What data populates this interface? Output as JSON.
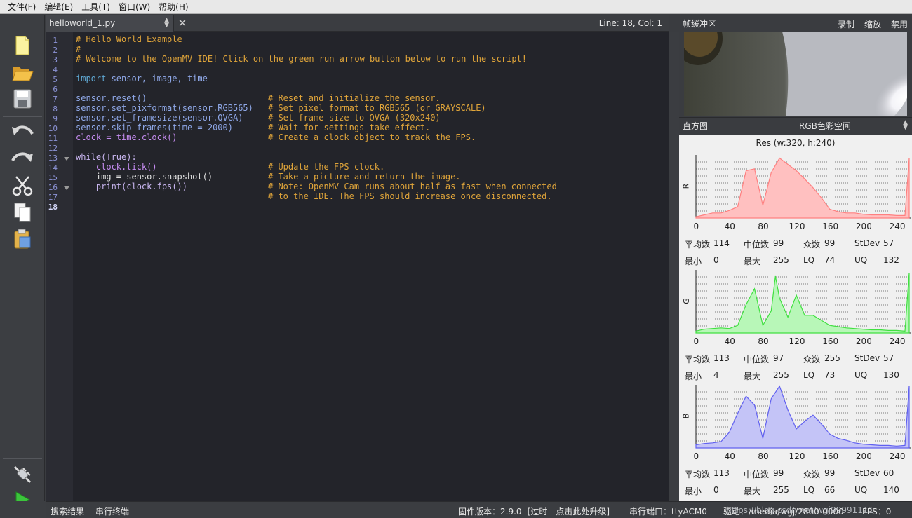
{
  "menu": [
    "文件(F)",
    "编辑(E)",
    "工具(T)",
    "窗口(W)",
    "帮助(H)"
  ],
  "editor": {
    "tab_name": "helloworld_1.py",
    "position": "Line: 18, Col: 1",
    "line_numbers": [
      "1",
      "2",
      "3",
      "4",
      "5",
      "6",
      "7",
      "8",
      "9",
      "10",
      "11",
      "12",
      "13",
      "14",
      "15",
      "16",
      "17",
      "18"
    ],
    "lines": {
      "l1": "# Hello World Example",
      "l2": "#",
      "l3": "# Welcome to the OpenMV IDE! Click on the green run arrow button below to run the script!",
      "l5_kw": "import",
      "l5_rest": " sensor, image, time",
      "l7_code": "sensor.reset()",
      "l7_comment": "# Reset and initialize the sensor.",
      "l8_code": "sensor.set_pixformat(sensor.RGB565)",
      "l8_comment": "# Set pixel format to RGB565 (or GRAYSCALE)",
      "l9_code": "sensor.set_framesize(sensor.QVGA)",
      "l9_comment": "# Set frame size to QVGA (320x240)",
      "l10_code": "sensor.skip_frames(time = 2000)",
      "l10_comment": "# Wait for settings take effect.",
      "l11_code": "clock = time.clock()",
      "l11_comment": "# Create a clock object to track the FPS.",
      "l13": "while(True):",
      "l14_code": "    clock.tick()",
      "l14_comment": "# Update the FPS clock.",
      "l15_code": "    img = sensor.snapshot()",
      "l15_comment": "# Take a picture and return the image.",
      "l16_code": "    print(clock.fps())",
      "l16_comment": "# Note: OpenMV Cam runs about half as fast when connected",
      "l17_comment": "# to the IDE. The FPS should increase once disconnected."
    }
  },
  "frame_buffer": {
    "title": "帧缓冲区",
    "record": "录制",
    "zoom": "缩放",
    "disable": "禁用"
  },
  "histogram": {
    "title": "直方图",
    "color_space": "RGB色彩空间",
    "resolution": "Res (w:320, h:240)",
    "ticks": [
      "0",
      "40",
      "80",
      "120",
      "160",
      "200",
      "240"
    ],
    "stat_labels": {
      "mean": "平均数",
      "median": "中位数",
      "mode": "众数",
      "stdev": "StDev",
      "min": "最小",
      "max": "最大",
      "lq": "LQ",
      "uq": "UQ"
    },
    "channels": [
      {
        "name": "R",
        "color": "#ff8080",
        "fill": "#ffc0c0",
        "mean": "114",
        "median": "99",
        "mode": "99",
        "stdev": "57",
        "min": "0",
        "max": "255",
        "lq": "74",
        "uq": "132"
      },
      {
        "name": "G",
        "color": "#40e040",
        "fill": "#b8f7b8",
        "mean": "113",
        "median": "97",
        "mode": "255",
        "stdev": "57",
        "min": "4",
        "max": "255",
        "lq": "73",
        "uq": "130"
      },
      {
        "name": "B",
        "color": "#6060f0",
        "fill": "#c4c4f7",
        "mean": "113",
        "median": "99",
        "mode": "99",
        "stdev": "60",
        "min": "0",
        "max": "255",
        "lq": "66",
        "uq": "140"
      }
    ]
  },
  "status": {
    "search_results": "搜索结果",
    "serial_terminal": "串行终端",
    "firmware": "固件版本：2.9.0- [过时 - 点击此处升级]",
    "serial_port": "串行端口：ttyACM0",
    "drive": "驱动：/media/wgj/2800-0000",
    "fps": "FPS：0",
    "watermark": "https://blog.csdn.net/wgj99991111"
  },
  "chart_data": [
    {
      "type": "area",
      "title": "R",
      "x": [
        0,
        10,
        20,
        30,
        40,
        50,
        60,
        70,
        80,
        90,
        100,
        110,
        120,
        130,
        140,
        150,
        160,
        170,
        180,
        190,
        200,
        210,
        220,
        230,
        240,
        250,
        255
      ],
      "values": [
        0.02,
        0.05,
        0.08,
        0.08,
        0.12,
        0.18,
        0.75,
        0.78,
        0.2,
        0.72,
        0.95,
        0.85,
        0.75,
        0.62,
        0.48,
        0.32,
        0.14,
        0.1,
        0.08,
        0.08,
        0.06,
        0.05,
        0.05,
        0.05,
        0.04,
        0.04,
        0.95
      ],
      "xlim": [
        0,
        255
      ]
    },
    {
      "type": "area",
      "title": "G",
      "x": [
        0,
        10,
        20,
        30,
        40,
        50,
        60,
        70,
        80,
        90,
        95,
        100,
        110,
        120,
        130,
        140,
        150,
        160,
        170,
        180,
        190,
        200,
        210,
        220,
        230,
        240,
        250,
        255
      ],
      "values": [
        0.03,
        0.06,
        0.07,
        0.08,
        0.07,
        0.12,
        0.45,
        0.7,
        0.12,
        0.35,
        0.9,
        0.55,
        0.25,
        0.6,
        0.28,
        0.28,
        0.2,
        0.12,
        0.1,
        0.08,
        0.07,
        0.06,
        0.05,
        0.05,
        0.04,
        0.04,
        0.03,
        0.95
      ],
      "xlim": [
        0,
        255
      ]
    },
    {
      "type": "area",
      "title": "B",
      "x": [
        0,
        10,
        20,
        30,
        40,
        50,
        60,
        70,
        80,
        90,
        100,
        110,
        120,
        130,
        140,
        150,
        160,
        170,
        180,
        190,
        200,
        210,
        220,
        230,
        240,
        250,
        255
      ],
      "values": [
        0.05,
        0.07,
        0.08,
        0.1,
        0.25,
        0.55,
        0.82,
        0.68,
        0.15,
        0.78,
        0.98,
        0.6,
        0.3,
        0.42,
        0.52,
        0.38,
        0.22,
        0.15,
        0.12,
        0.08,
        0.06,
        0.05,
        0.04,
        0.04,
        0.03,
        0.04,
        0.98
      ],
      "xlim": [
        0,
        255
      ]
    }
  ]
}
